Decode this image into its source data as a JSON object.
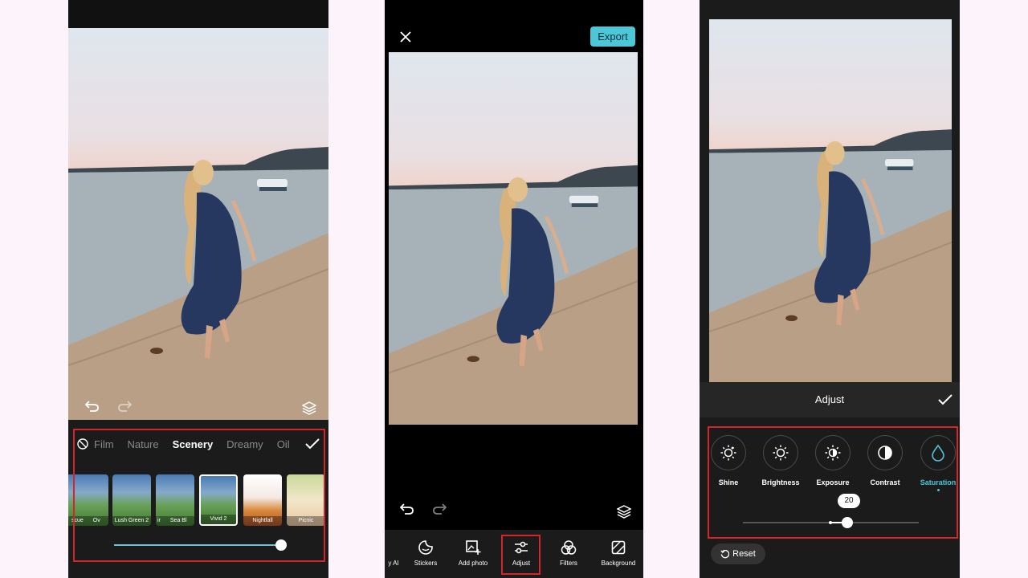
{
  "colors": {
    "background": "#fdf4fb",
    "accent": "#4cc7d8",
    "highlight_box": "#d4252b",
    "panel_dark": "#1b1b1b"
  },
  "panel1": {
    "categories": [
      {
        "label": "Film",
        "active": false
      },
      {
        "label": "Nature",
        "active": false
      },
      {
        "label": "Scenery",
        "active": true
      },
      {
        "label": "Dreamy",
        "active": false
      },
      {
        "label": "Oil",
        "active": false
      }
    ],
    "filters": [
      {
        "label": "scue",
        "selected": false
      },
      {
        "label": "Ov",
        "selected": false
      },
      {
        "label": "Lush Green 2",
        "selected": false
      },
      {
        "label": "ir",
        "selected": false
      },
      {
        "label": "Sea Bl",
        "selected": false
      },
      {
        "label": "Vivid 2",
        "selected": true
      },
      {
        "label": "Nightfall",
        "selected": false
      },
      {
        "label": "Picnic",
        "selected": false
      }
    ],
    "intensity": 1.0,
    "icons": {
      "undo": "undo-icon",
      "redo": "redo-icon",
      "layers": "layers-icon",
      "none": "no-filter-icon",
      "confirm": "check-icon"
    }
  },
  "panel2": {
    "export_label": "Export",
    "toolbar": [
      {
        "label": "y AI",
        "icon": "ai-icon"
      },
      {
        "label": "Stickers",
        "icon": "sticker-icon"
      },
      {
        "label": "Add photo",
        "icon": "add-photo-icon"
      },
      {
        "label": "Adjust",
        "icon": "adjust-icon"
      },
      {
        "label": "Filters",
        "icon": "filters-icon"
      },
      {
        "label": "Background",
        "icon": "background-icon"
      }
    ]
  },
  "panel3": {
    "title": "Adjust",
    "tools": [
      {
        "label": "Shine",
        "icon": "shine-icon",
        "active": false
      },
      {
        "label": "Brightness",
        "icon": "brightness-icon",
        "active": false
      },
      {
        "label": "Exposure",
        "icon": "exposure-icon",
        "active": false
      },
      {
        "label": "Contrast",
        "icon": "contrast-icon",
        "active": false
      },
      {
        "label": "Saturation",
        "icon": "saturation-icon",
        "active": true
      }
    ],
    "value": "20",
    "reset_label": "Reset"
  }
}
